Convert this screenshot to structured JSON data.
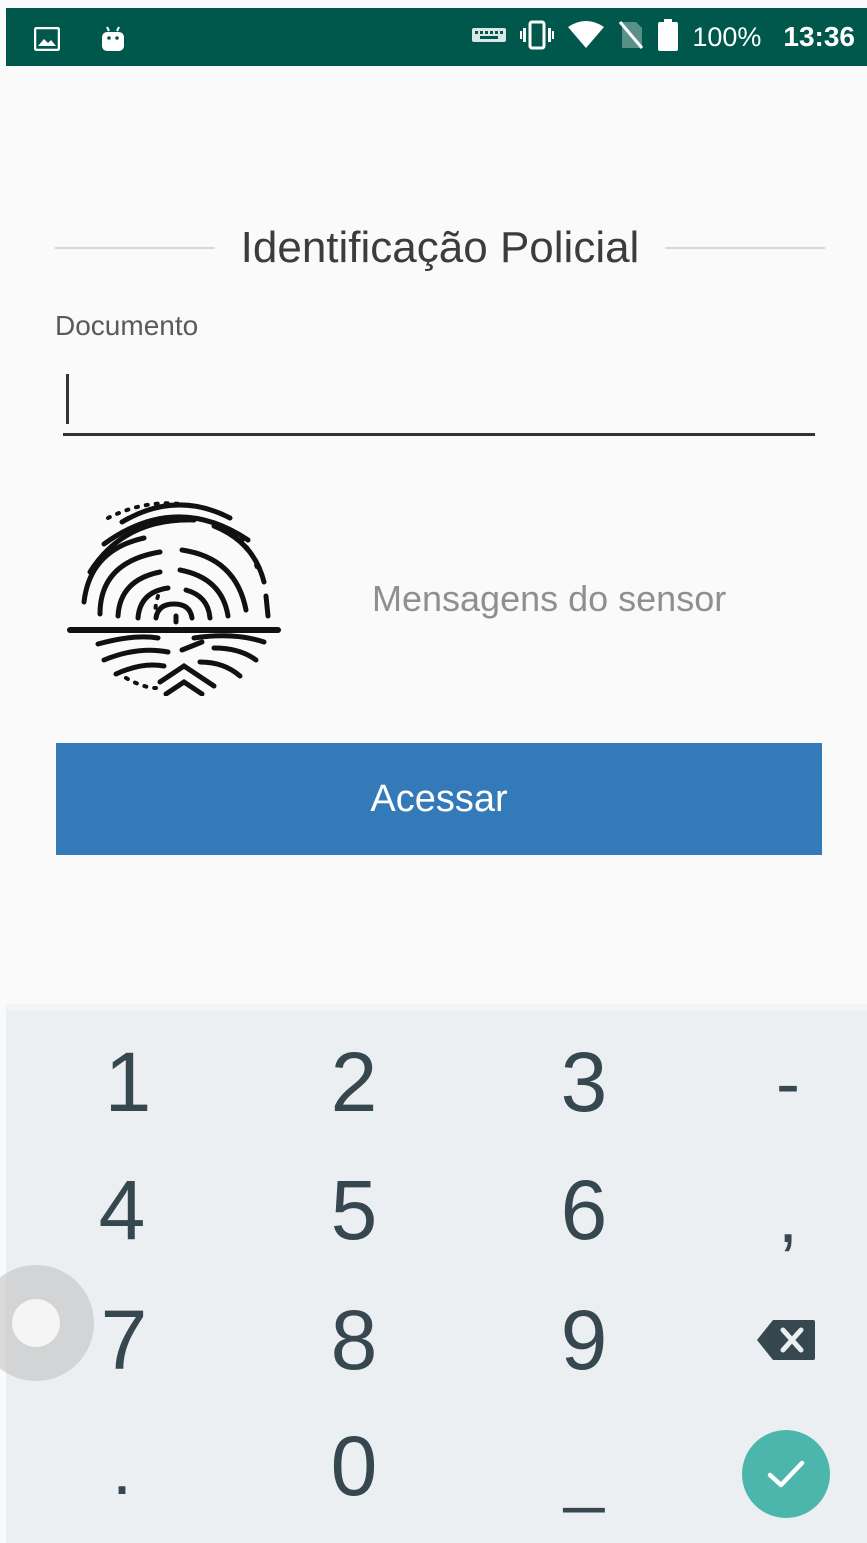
{
  "status_bar": {
    "battery": "100%",
    "time": "13:36",
    "icons": [
      "gallery-icon",
      "android-icon",
      "keyboard-icon",
      "vibrate-icon",
      "wifi-icon",
      "no-sim-icon",
      "battery-icon"
    ]
  },
  "form": {
    "title": "Identificação Policial",
    "document_label": "Documento",
    "document_value": "",
    "sensor_message": "Mensagens do sensor",
    "access_label": "Acessar"
  },
  "keypad": {
    "keys": [
      "1",
      "2",
      "3",
      "-",
      "4",
      "5",
      "6",
      ",",
      "7",
      "8",
      "9",
      ".",
      "0",
      "_"
    ]
  },
  "colors": {
    "status_bar": "#00574b",
    "button": "#357ab8",
    "keypad_bg": "#eceff1",
    "confirm": "#4db6ac"
  }
}
